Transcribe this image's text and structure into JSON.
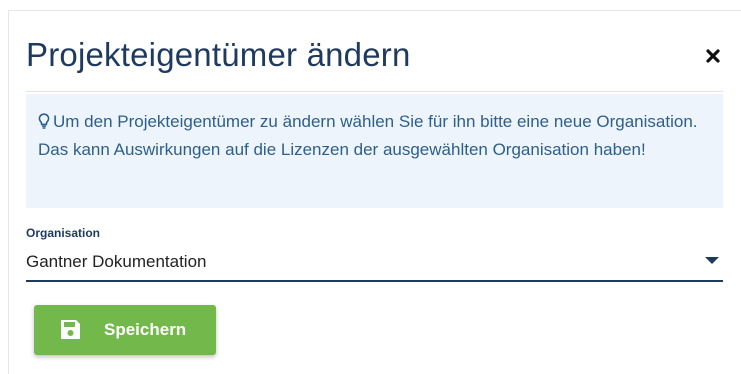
{
  "dialog": {
    "title": "Projekteigentümer ändern",
    "close_icon": "close-icon"
  },
  "info": {
    "icon": "lightbulb-icon",
    "text": "Um den Projekteigentümer zu ändern wählen Sie für ihn bitte eine neue Organisation. Das kann Auswirkungen auf die Lizenzen der ausgewählten Organisation haben!"
  },
  "organisation": {
    "label": "Organisation",
    "value": "Gantner Dokumentation"
  },
  "save": {
    "label": "Speichern",
    "icon": "floppy-disk-icon"
  },
  "colors": {
    "title": "#1e3a5f",
    "info_bg": "#edf4fc",
    "info_text": "#2e5f8a",
    "button": "#72b84a"
  }
}
